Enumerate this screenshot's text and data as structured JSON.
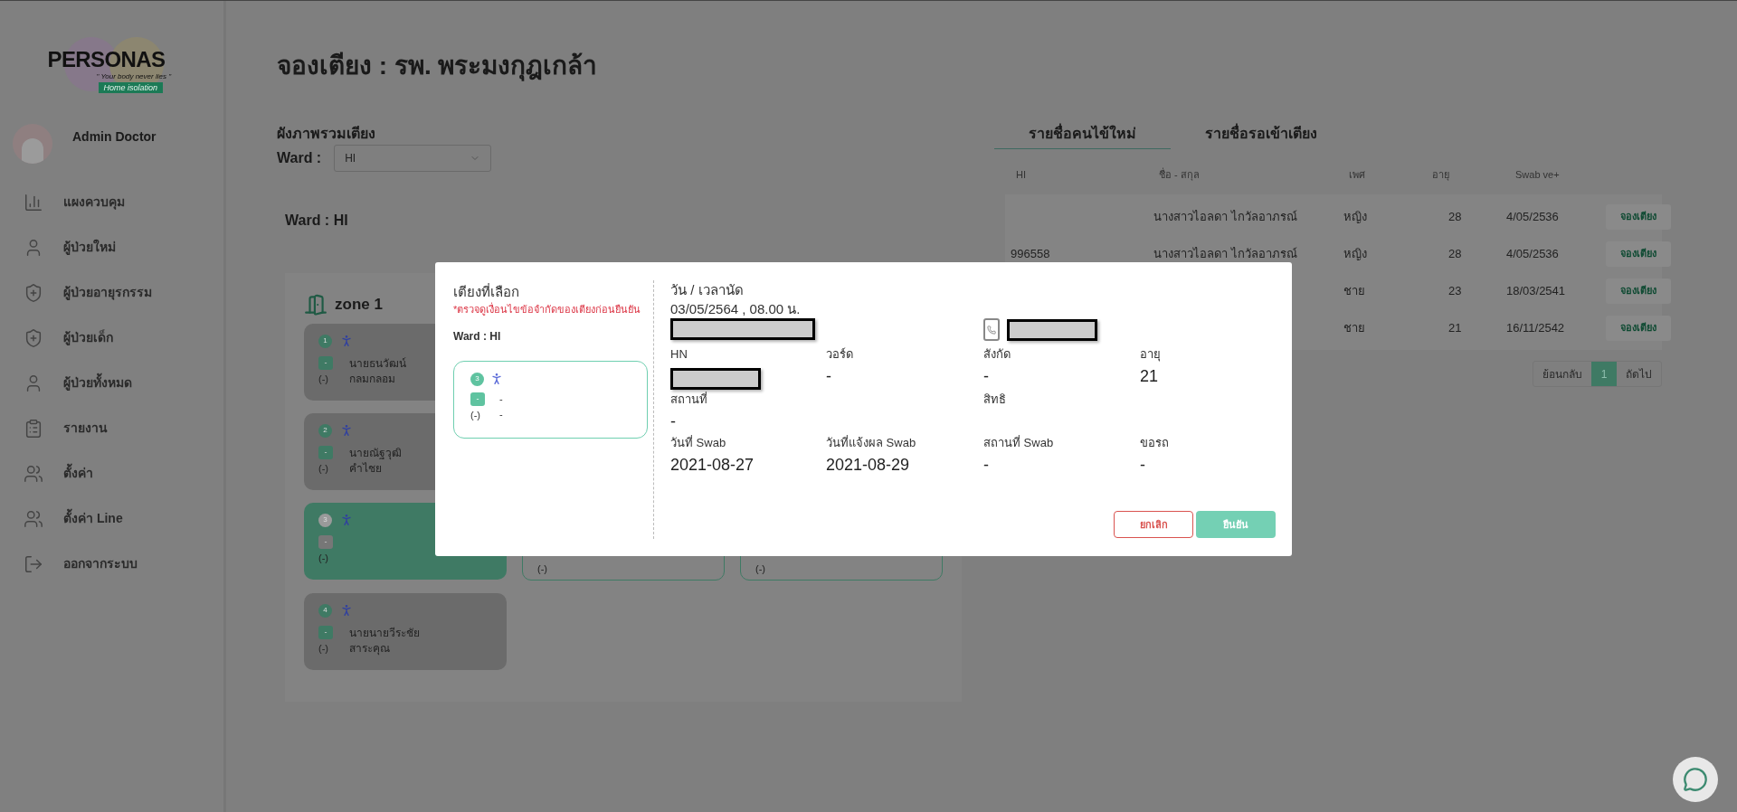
{
  "sidebar": {
    "logo": {
      "title": "PERSONAS",
      "tagline": "\" Your body never lies \"",
      "badge": "Home isolation"
    },
    "user": {
      "name": "Admin Doctor"
    },
    "items": [
      {
        "label": "แผงควบคุม"
      },
      {
        "label": "ผู้ป่วยใหม่"
      },
      {
        "label": "ผู้ป่วยอายุรกรรม"
      },
      {
        "label": "ผู้ป่วยเด็ก"
      },
      {
        "label": "ผู้ป่วยทั้งหมด"
      },
      {
        "label": "รายงาน"
      },
      {
        "label": "ตั้งค่า"
      },
      {
        "label": "ตั้งค่า Line"
      },
      {
        "label": "ออกจากระบบ"
      }
    ]
  },
  "page_title": "จองเตียง : รพ. พระมงกุฎเกล้า",
  "bed_map": {
    "title": "ผังภาพรวมเตียง",
    "ward_label": "Ward :",
    "ward_select": {
      "value": "HI"
    },
    "ward_heading": "Ward : HI",
    "zone": "zone 1",
    "beds": [
      {
        "number": "1",
        "badge": "-",
        "code": "(-)",
        "name": "นายธนวัฒน์",
        "surname": "กลมกลอม",
        "selected": false
      },
      {
        "number": "2",
        "badge": "-",
        "code": "(-)",
        "name": "นายณัฐวุฒิ",
        "surname": "คำไชย",
        "selected": false
      },
      {
        "number": "3",
        "badge": "-",
        "code": "(-)",
        "selected": true
      },
      {
        "number": "4",
        "badge": "-",
        "code": "(-)",
        "name": "นายนายวีระชัย",
        "surname": "สาระคุณ",
        "selected": false
      }
    ],
    "partial_beds": [
      {
        "code": "(-)"
      },
      {
        "code": "(-)"
      }
    ]
  },
  "patients": {
    "tabs": [
      {
        "label": "รายชื่อคนไข้ใหม่",
        "selected": true
      },
      {
        "label": "รายชื่อรอเข้าเตียง",
        "selected": false
      }
    ],
    "columns": [
      "HI",
      "ชื่อ - สกุล",
      "เพศ",
      "อายุ",
      "Swab ve+"
    ],
    "rows": [
      {
        "hi": "",
        "name": "นางสาวไอลดา ไกวัลอาภรณ์",
        "gender": "หญิง",
        "age": "28",
        "swab": "4/05/2536",
        "action": "จองเตียง"
      },
      {
        "hi": "996558",
        "name": "นางสาวไอลดา ไกวัลอาภรณ์",
        "gender": "หญิง",
        "age": "28",
        "swab": "4/05/2536",
        "action": "จองเตียง"
      },
      {
        "gender": "ชาย",
        "age": "23",
        "swab": "18/03/2541",
        "action": "จองเตียง"
      },
      {
        "gender": "ชาย",
        "age": "21",
        "swab": "16/11/2542",
        "action": "จองเตียง"
      }
    ],
    "pagination": {
      "prev": "ย้อนกลับ",
      "pages": [
        {
          "label": "1",
          "selected": true
        }
      ],
      "next": "ถัดไป"
    }
  },
  "modal": {
    "title": "เตียงที่เลือก",
    "warning": "*ตรวจดูเงื่อนไขข้อจำกัดของเตียงก่อนยืนยัน",
    "ward": "Ward : HI",
    "bed": {
      "number": "3",
      "badge": "-",
      "line1": "-",
      "code": "(-)",
      "line2": "-"
    },
    "appointment_label": "วัน / เวลานัด",
    "appointment": "03/05/2564 , 08.00 น.",
    "row1": [
      {
        "label": "HN",
        "redacted": true
      },
      {
        "label": "วอร์ด",
        "value": "-"
      },
      {
        "label": "สังกัด",
        "value": "-"
      },
      {
        "label": "อายุ",
        "value": "21"
      }
    ],
    "row2": [
      {
        "label": "สถานที่",
        "value": "-"
      },
      {
        "label": "สิทธิ"
      }
    ],
    "row3": [
      {
        "label": "วันที่ Swab",
        "value": "2021-08-27"
      },
      {
        "label": "วันที่แจ้งผล Swab",
        "value": "2021-08-29"
      },
      {
        "label": "สถานที่ Swab",
        "value": "-"
      },
      {
        "label": "ขอรถ",
        "value": "-"
      }
    ],
    "cancel": "ยกเลิก",
    "confirm": "ยืนยัน"
  }
}
